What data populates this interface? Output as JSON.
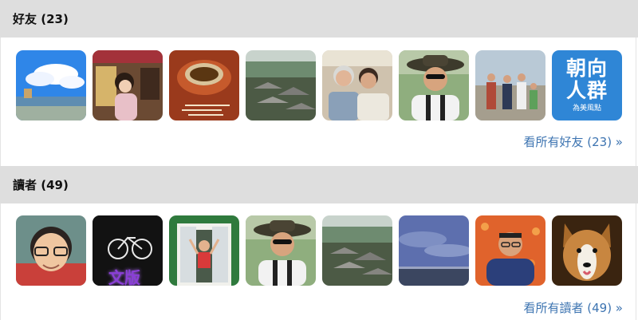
{
  "friends": {
    "title": "好友",
    "count": "(23)",
    "see_all": "看所有好友 (23) »",
    "avatars": [
      {
        "icon": "photo-sky-landscape"
      },
      {
        "icon": "photo-girl-cafe"
      },
      {
        "icon": "photo-tea-cup"
      },
      {
        "icon": "photo-village-rooftops"
      },
      {
        "icon": "photo-elderly-couple"
      },
      {
        "icon": "photo-man-hat-sunglasses"
      },
      {
        "icon": "photo-family-beach"
      },
      {
        "icon": "logo-text",
        "lines": [
          "朝向",
          "人群"
        ],
        "sub": "為美風點"
      }
    ]
  },
  "readers": {
    "title": "讀者",
    "count": "(49)",
    "see_all": "看所有讀者 (49) »",
    "avatars": [
      {
        "icon": "photo-boy-glasses"
      },
      {
        "icon": "photo-bicycle-neon",
        "neon": "文版"
      },
      {
        "icon": "photo-woman-window"
      },
      {
        "icon": "photo-man-hat-sunglasses"
      },
      {
        "icon": "photo-village-rooftops"
      },
      {
        "icon": "photo-cloudy-sky"
      },
      {
        "icon": "photo-man-flowers"
      },
      {
        "icon": "photo-collie-dog"
      }
    ]
  },
  "colors": {
    "header_bg": "#dedede",
    "link": "#3d74b1",
    "logo_blue": "#2f86d6"
  }
}
